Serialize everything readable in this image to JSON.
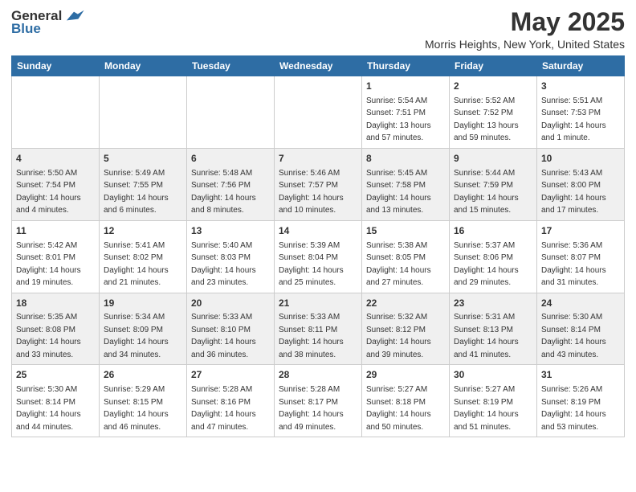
{
  "logo": {
    "general": "General",
    "blue": "Blue"
  },
  "header": {
    "month_title": "May 2025",
    "location": "Morris Heights, New York, United States"
  },
  "weekdays": [
    "Sunday",
    "Monday",
    "Tuesday",
    "Wednesday",
    "Thursday",
    "Friday",
    "Saturday"
  ],
  "weeks": [
    [
      {
        "day": "",
        "info": ""
      },
      {
        "day": "",
        "info": ""
      },
      {
        "day": "",
        "info": ""
      },
      {
        "day": "",
        "info": ""
      },
      {
        "day": "1",
        "info": "Sunrise: 5:54 AM\nSunset: 7:51 PM\nDaylight: 13 hours\nand 57 minutes."
      },
      {
        "day": "2",
        "info": "Sunrise: 5:52 AM\nSunset: 7:52 PM\nDaylight: 13 hours\nand 59 minutes."
      },
      {
        "day": "3",
        "info": "Sunrise: 5:51 AM\nSunset: 7:53 PM\nDaylight: 14 hours\nand 1 minute."
      }
    ],
    [
      {
        "day": "4",
        "info": "Sunrise: 5:50 AM\nSunset: 7:54 PM\nDaylight: 14 hours\nand 4 minutes."
      },
      {
        "day": "5",
        "info": "Sunrise: 5:49 AM\nSunset: 7:55 PM\nDaylight: 14 hours\nand 6 minutes."
      },
      {
        "day": "6",
        "info": "Sunrise: 5:48 AM\nSunset: 7:56 PM\nDaylight: 14 hours\nand 8 minutes."
      },
      {
        "day": "7",
        "info": "Sunrise: 5:46 AM\nSunset: 7:57 PM\nDaylight: 14 hours\nand 10 minutes."
      },
      {
        "day": "8",
        "info": "Sunrise: 5:45 AM\nSunset: 7:58 PM\nDaylight: 14 hours\nand 13 minutes."
      },
      {
        "day": "9",
        "info": "Sunrise: 5:44 AM\nSunset: 7:59 PM\nDaylight: 14 hours\nand 15 minutes."
      },
      {
        "day": "10",
        "info": "Sunrise: 5:43 AM\nSunset: 8:00 PM\nDaylight: 14 hours\nand 17 minutes."
      }
    ],
    [
      {
        "day": "11",
        "info": "Sunrise: 5:42 AM\nSunset: 8:01 PM\nDaylight: 14 hours\nand 19 minutes."
      },
      {
        "day": "12",
        "info": "Sunrise: 5:41 AM\nSunset: 8:02 PM\nDaylight: 14 hours\nand 21 minutes."
      },
      {
        "day": "13",
        "info": "Sunrise: 5:40 AM\nSunset: 8:03 PM\nDaylight: 14 hours\nand 23 minutes."
      },
      {
        "day": "14",
        "info": "Sunrise: 5:39 AM\nSunset: 8:04 PM\nDaylight: 14 hours\nand 25 minutes."
      },
      {
        "day": "15",
        "info": "Sunrise: 5:38 AM\nSunset: 8:05 PM\nDaylight: 14 hours\nand 27 minutes."
      },
      {
        "day": "16",
        "info": "Sunrise: 5:37 AM\nSunset: 8:06 PM\nDaylight: 14 hours\nand 29 minutes."
      },
      {
        "day": "17",
        "info": "Sunrise: 5:36 AM\nSunset: 8:07 PM\nDaylight: 14 hours\nand 31 minutes."
      }
    ],
    [
      {
        "day": "18",
        "info": "Sunrise: 5:35 AM\nSunset: 8:08 PM\nDaylight: 14 hours\nand 33 minutes."
      },
      {
        "day": "19",
        "info": "Sunrise: 5:34 AM\nSunset: 8:09 PM\nDaylight: 14 hours\nand 34 minutes."
      },
      {
        "day": "20",
        "info": "Sunrise: 5:33 AM\nSunset: 8:10 PM\nDaylight: 14 hours\nand 36 minutes."
      },
      {
        "day": "21",
        "info": "Sunrise: 5:33 AM\nSunset: 8:11 PM\nDaylight: 14 hours\nand 38 minutes."
      },
      {
        "day": "22",
        "info": "Sunrise: 5:32 AM\nSunset: 8:12 PM\nDaylight: 14 hours\nand 39 minutes."
      },
      {
        "day": "23",
        "info": "Sunrise: 5:31 AM\nSunset: 8:13 PM\nDaylight: 14 hours\nand 41 minutes."
      },
      {
        "day": "24",
        "info": "Sunrise: 5:30 AM\nSunset: 8:14 PM\nDaylight: 14 hours\nand 43 minutes."
      }
    ],
    [
      {
        "day": "25",
        "info": "Sunrise: 5:30 AM\nSunset: 8:14 PM\nDaylight: 14 hours\nand 44 minutes."
      },
      {
        "day": "26",
        "info": "Sunrise: 5:29 AM\nSunset: 8:15 PM\nDaylight: 14 hours\nand 46 minutes."
      },
      {
        "day": "27",
        "info": "Sunrise: 5:28 AM\nSunset: 8:16 PM\nDaylight: 14 hours\nand 47 minutes."
      },
      {
        "day": "28",
        "info": "Sunrise: 5:28 AM\nSunset: 8:17 PM\nDaylight: 14 hours\nand 49 minutes."
      },
      {
        "day": "29",
        "info": "Sunrise: 5:27 AM\nSunset: 8:18 PM\nDaylight: 14 hours\nand 50 minutes."
      },
      {
        "day": "30",
        "info": "Sunrise: 5:27 AM\nSunset: 8:19 PM\nDaylight: 14 hours\nand 51 minutes."
      },
      {
        "day": "31",
        "info": "Sunrise: 5:26 AM\nSunset: 8:19 PM\nDaylight: 14 hours\nand 53 minutes."
      }
    ]
  ]
}
